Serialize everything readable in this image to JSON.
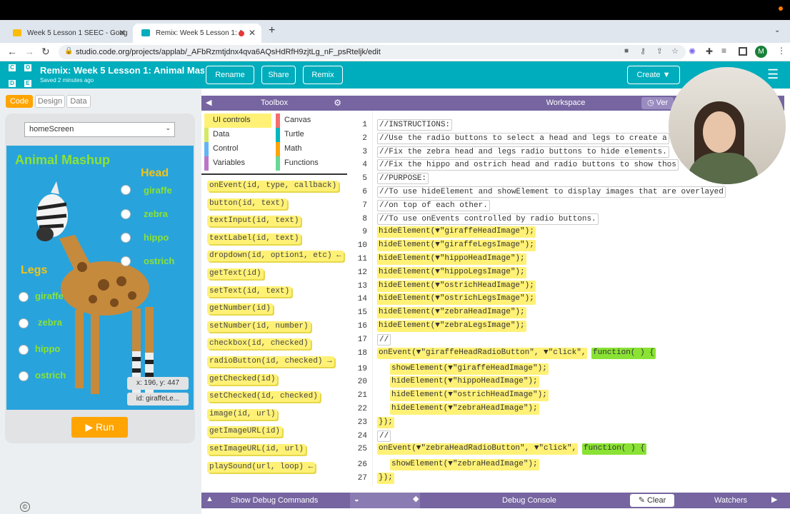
{
  "browser": {
    "tabs": [
      {
        "title": "Week 5 Lesson 1 SEEC - Goog",
        "active": false,
        "icon": "docs-icon"
      },
      {
        "title": "Remix: Week 5 Lesson 1: A",
        "active": true,
        "icon": "code-org-icon"
      }
    ],
    "url": "studio.code.org/projects/applab/_AFbRzmtjdnx4qva6AQsHdRfH9zjtLg_nF_psRteljk/edit",
    "profile_initial": "M"
  },
  "header": {
    "logo_letters": [
      "C",
      "O",
      "D",
      "E"
    ],
    "project_title": "Remix: Week 5 Lesson 1: Animal Mas...",
    "saved_status": "Saved 2 minutes ago",
    "buttons": {
      "rename": "Rename",
      "share": "Share",
      "remix": "Remix",
      "create": "Create"
    },
    "colors": {
      "teal": "#00adbc"
    }
  },
  "left_panel": {
    "modes": [
      "Code",
      "Design",
      "Data"
    ],
    "active_mode": "Code",
    "screen_select": "homeScreen",
    "app": {
      "title": "Animal Mashup",
      "head_label": "Head",
      "head_options": [
        "giraffe",
        "zebra",
        "hippo",
        "ostrich"
      ],
      "legs_label": "Legs",
      "legs_options": [
        "giraffe",
        "zebra",
        "hippo",
        "ostrich"
      ]
    },
    "coords": "x: 196, y: 447",
    "id_tip": "id: giraffeLe...",
    "run_label": "Run"
  },
  "toolbox": {
    "title": "Toolbox",
    "categories": [
      {
        "name": "UI controls",
        "color": "#fff176"
      },
      {
        "name": "Canvas",
        "color": "#f46d6d"
      },
      {
        "name": "Data",
        "color": "#d3e965"
      },
      {
        "name": "Turtle",
        "color": "#00b8bf"
      },
      {
        "name": "Control",
        "color": "#64b5f6"
      },
      {
        "name": "Math",
        "color": "#ffa400"
      },
      {
        "name": "Variables",
        "color": "#bb77c7"
      },
      {
        "name": "Functions",
        "color": "#68d995"
      }
    ],
    "blocks": [
      "onEvent(id, type, callback)",
      "button(id, text)",
      "textInput(id, text)",
      "textLabel(id, text)",
      "dropdown(id, option1, etc) ←",
      "getText(id)",
      "setText(id, text)",
      "getNumber(id)",
      "setNumber(id, number)",
      "checkbox(id, checked)",
      "radioButton(id, checked) →",
      "getChecked(id)",
      "setChecked(id, checked)",
      "image(id, url)",
      "getImageURL(id)",
      "setImageURL(id, url)",
      "playSound(url, loop) ←"
    ]
  },
  "workspace": {
    "title": "Workspace",
    "version_label": "Ver",
    "lines": [
      {
        "n": "1",
        "text": "//INSTRUCTIONS:",
        "kind": "comment",
        "indent": 0
      },
      {
        "n": "2",
        "text": "//Use the radio buttons to select a head and legs to create a",
        "kind": "comment",
        "indent": 0
      },
      {
        "n": "3",
        "text": "//Fix the zebra head and legs radio buttons to hide elements.",
        "kind": "comment",
        "indent": 0
      },
      {
        "n": "4",
        "text": "//Fix the hippo and ostrich head and radio buttons to show thos",
        "kind": "comment",
        "indent": 0
      },
      {
        "n": "5",
        "text": "//PURPOSE:",
        "kind": "comment",
        "indent": 0
      },
      {
        "n": "6",
        "text": "//To use hideElement and showElement to display images that are overlayed",
        "kind": "comment",
        "indent": 0
      },
      {
        "n": "7",
        "text": "//on top of each other.",
        "kind": "comment",
        "indent": 0
      },
      {
        "n": "8",
        "text": "//To use onEvents controlled by radio buttons.",
        "kind": "comment",
        "indent": 0
      },
      {
        "n": "9",
        "text": "hideElement(▼\"giraffeHeadImage\");",
        "kind": "code",
        "indent": 0
      },
      {
        "n": "10",
        "text": "hideElement(▼\"giraffeLegsImage\");",
        "kind": "code",
        "indent": 0
      },
      {
        "n": "11",
        "text": "hideElement(▼\"hippoHeadImage\");",
        "kind": "code",
        "indent": 0
      },
      {
        "n": "12",
        "text": "hideElement(▼\"hippoLegsImage\");",
        "kind": "code",
        "indent": 0
      },
      {
        "n": "13",
        "text": "hideElement(▼\"ostrichHeadImage\");",
        "kind": "code",
        "indent": 0
      },
      {
        "n": "14",
        "text": "hideElement(▼\"ostrichLegsImage\");",
        "kind": "code",
        "indent": 0
      },
      {
        "n": "15",
        "text": "hideElement(▼\"zebraHeadImage\");",
        "kind": "code",
        "indent": 0
      },
      {
        "n": "16",
        "text": "hideElement(▼\"zebraLegsImage\");",
        "kind": "code",
        "indent": 0
      },
      {
        "n": "17",
        "text": "//",
        "kind": "comment",
        "indent": 0
      },
      {
        "n": "18",
        "text": "onEvent(▼\"giraffeHeadRadioButton\", ▼\"click\",",
        "kind": "code",
        "indent": 0,
        "fn": "function( ) {"
      },
      {
        "n": "19",
        "text": "showElement(▼\"giraffeHeadImage\");",
        "kind": "code",
        "indent": 1
      },
      {
        "n": "20",
        "text": "hideElement(▼\"hippoHeadImage\");",
        "kind": "code",
        "indent": 1
      },
      {
        "n": "21",
        "text": "hideElement(▼\"ostrichHeadImage\");",
        "kind": "code",
        "indent": 1
      },
      {
        "n": "22",
        "text": "hideElement(▼\"zebraHeadImage\");",
        "kind": "code",
        "indent": 1
      },
      {
        "n": "23",
        "text": "});",
        "kind": "end",
        "indent": 0
      },
      {
        "n": "24",
        "text": "//",
        "kind": "comment",
        "indent": 0
      },
      {
        "n": "25",
        "text": "onEvent(▼\"zebraHeadRadioButton\", ▼\"click\",",
        "kind": "code",
        "indent": 0,
        "fn": "function( ) {"
      },
      {
        "n": "26",
        "text": "showElement(▼\"zebraHeadImage\");",
        "kind": "code",
        "indent": 1
      },
      {
        "n": "27",
        "text": "});",
        "kind": "end",
        "indent": 0
      }
    ]
  },
  "bottom": {
    "show_debug": "Show Debug Commands",
    "debug_console": "Debug Console",
    "clear": "Clear",
    "watchers": "Watchers"
  },
  "footer": {
    "copyright": "©"
  }
}
